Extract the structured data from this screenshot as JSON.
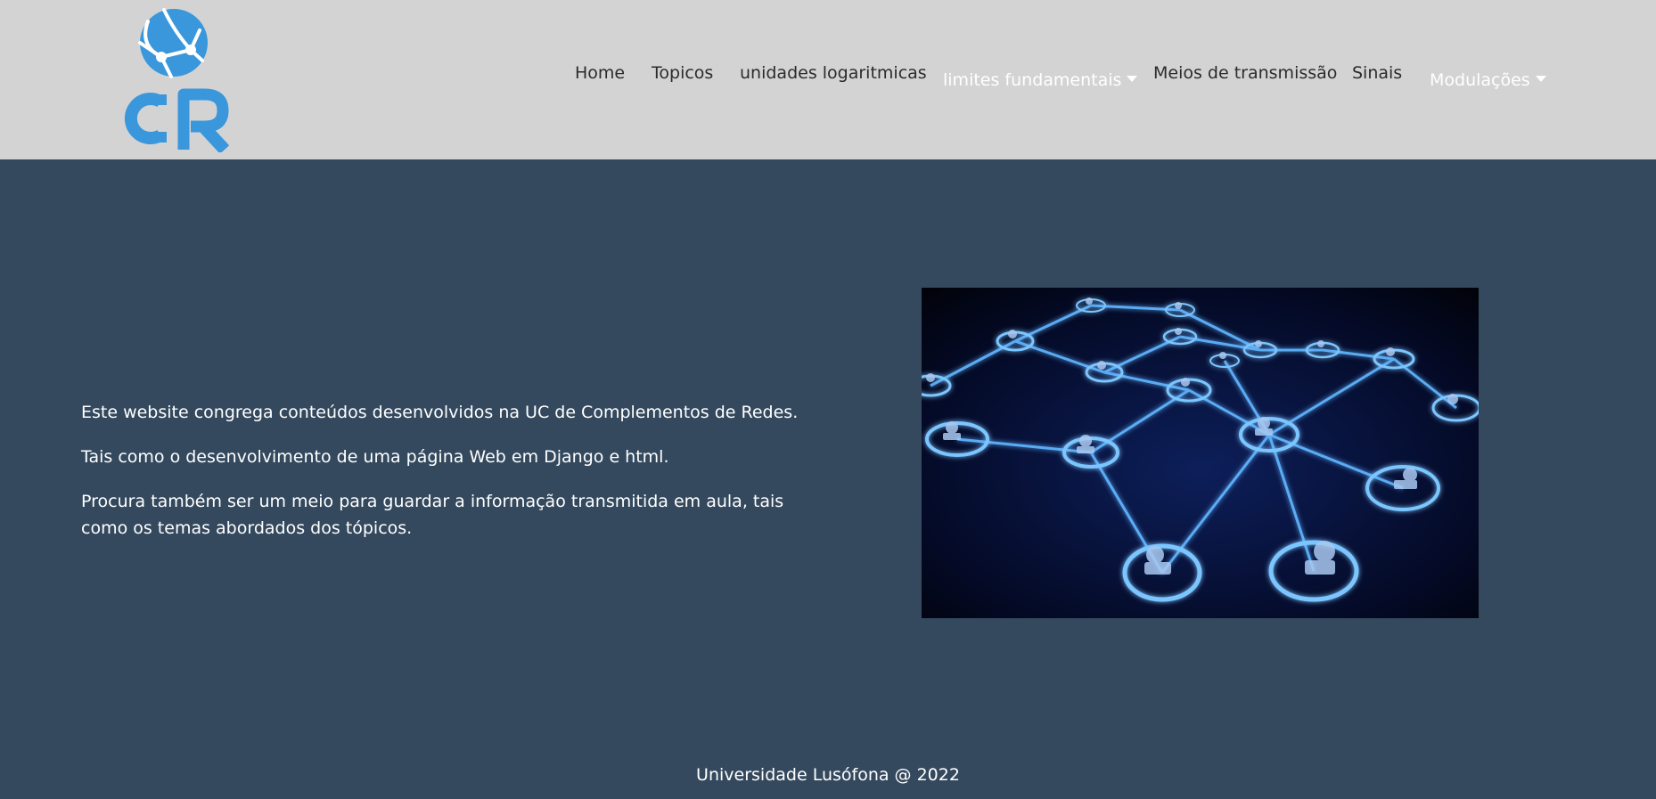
{
  "brand": {
    "logo_text": "CR",
    "accent_color": "#3a97dc"
  },
  "nav": {
    "home": "Home",
    "topicos": "Topicos",
    "unidades": "unidades logaritmicas",
    "limites": "limites fundamentais",
    "meios": "Meios de transmissão",
    "sinais": "Sinais",
    "modulacoes": "Modulações"
  },
  "main": {
    "paragraphs": [
      "Este website congrega conteúdos desenvolvidos na UC de Complementos de Redes.",
      "Tais como o desenvolvimento de uma página Web em Django e html.",
      "Procura também ser um meio para guardar a informação transmitida em aula, tais como os temas abordados dos tópicos."
    ],
    "image_icon": "network-nodes-image"
  },
  "footer": {
    "text": "Universidade Lusófona @ 2022"
  },
  "colors": {
    "header_bg": "#d3d3d3",
    "body_bg": "#34495e"
  }
}
